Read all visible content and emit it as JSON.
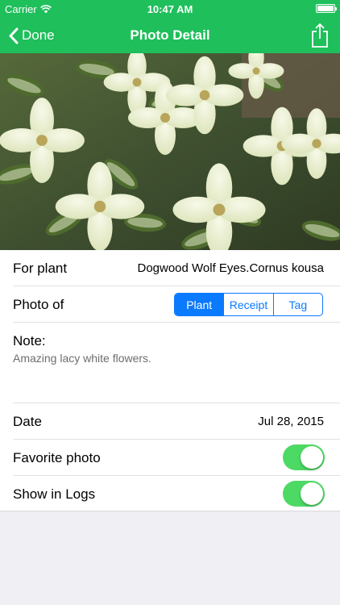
{
  "colors": {
    "brand": "#1fbf5b",
    "accent": "#0a7aff",
    "toggle_on": "#4cd964"
  },
  "status": {
    "carrier": "Carrier",
    "time": "10:47 AM",
    "wifi_icon": "wifi-icon",
    "battery_level": 1.0
  },
  "nav": {
    "back_label": "Done",
    "back_icon": "chevron-left-icon",
    "title": "Photo Detail",
    "share_icon": "share-icon"
  },
  "photo": {
    "description_icon": "plant-photo"
  },
  "rows": {
    "for_plant": {
      "label": "For plant",
      "value": "Dogwood Wolf Eyes.Cornus kousa"
    },
    "photo_of": {
      "label": "Photo of",
      "options": [
        "Plant",
        "Receipt",
        "Tag"
      ],
      "selected": "Plant"
    },
    "note": {
      "label": "Note:",
      "text": "Amazing lacy white flowers."
    },
    "date": {
      "label": "Date",
      "value": "Jul 28, 2015"
    },
    "favorite": {
      "label": "Favorite photo",
      "on": true
    },
    "show_in_logs": {
      "label": "Show in Logs",
      "on": true
    }
  }
}
